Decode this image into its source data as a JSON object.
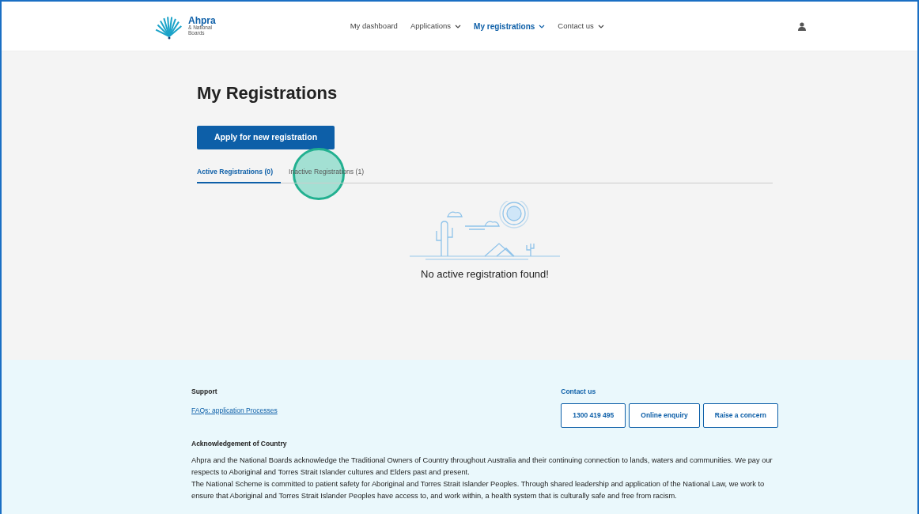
{
  "header": {
    "logo": {
      "name": "Ahpra",
      "line_2": "& National",
      "line_3": "Boards"
    },
    "nav": [
      {
        "label": "My dashboard",
        "dropdown": false,
        "selected": false
      },
      {
        "label": "Applications",
        "dropdown": true,
        "selected": false
      },
      {
        "label": "My registrations",
        "dropdown": true,
        "selected": true
      },
      {
        "label": "Contact us",
        "dropdown": true,
        "selected": false
      }
    ]
  },
  "page": {
    "title": "My Registrations",
    "apply_button": "Apply for new registration",
    "tabs": [
      {
        "label": "Active Registrations (0)",
        "selected": true
      },
      {
        "label": "Inactive Registrations (1)",
        "selected": false
      }
    ],
    "empty_message": "No active registration found!"
  },
  "footer": {
    "support": {
      "heading": "Support",
      "links": [
        "FAQs: application Processes"
      ]
    },
    "contact": {
      "heading": "Contact us",
      "buttons": [
        "1300 419 495",
        "Online enquiry",
        "Raise a concern"
      ]
    },
    "acknowledgement": {
      "heading": "Acknowledgement of Country",
      "paragraphs": [
        "Ahpra and the National Boards acknowledge the Traditional Owners of Country throughout Australia and their continuing connection to lands, waters and communities. We pay our respects to Aboriginal and Torres Strait Islander cultures and Elders past and present.",
        "The National Scheme is committed to patient safety for Aboriginal and Torres Strait Islander Peoples. Through shared leadership and application of the National Law, we work to ensure that Aboriginal and Torres Strait Islander Peoples have access to, and work within, a health system that is culturally safe and free from racism."
      ]
    }
  }
}
